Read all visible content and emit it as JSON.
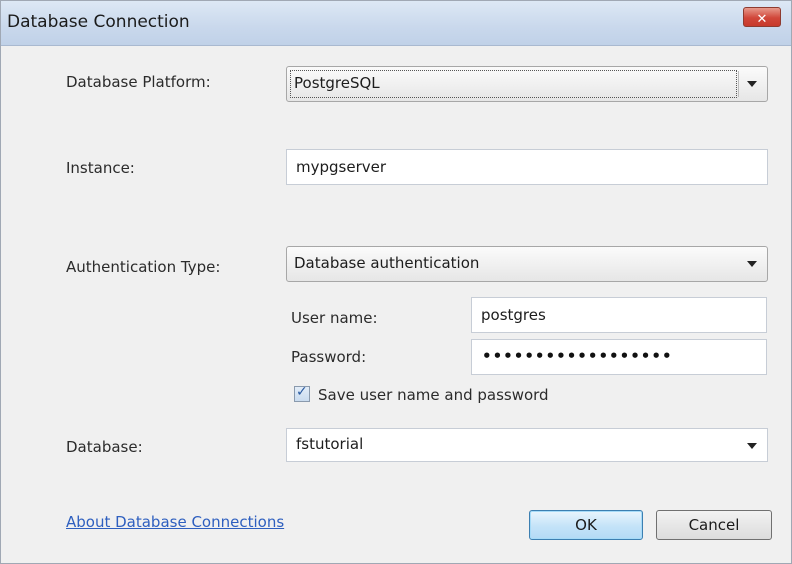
{
  "window": {
    "title": "Database Connection",
    "close_glyph": "✕"
  },
  "form": {
    "platform_label": "Database Platform:",
    "platform_value": "PostgreSQL",
    "instance_label": "Instance:",
    "instance_value": "mypgserver",
    "auth_label": "Authentication Type:",
    "auth_value": "Database authentication",
    "username_label": "User name:",
    "username_value": "postgres",
    "password_label": "Password:",
    "password_value": "••••••••••••••••••",
    "save_checkbox_label": "Save user name and password",
    "save_checked": true,
    "database_label": "Database:",
    "database_value": "fstutorial"
  },
  "footer": {
    "help_link": "About Database Connections",
    "ok_label": "OK",
    "cancel_label": "Cancel"
  },
  "colors": {
    "link": "#2e5fbf",
    "default_button": "#c4e3f8",
    "close_button": "#d1473a"
  }
}
